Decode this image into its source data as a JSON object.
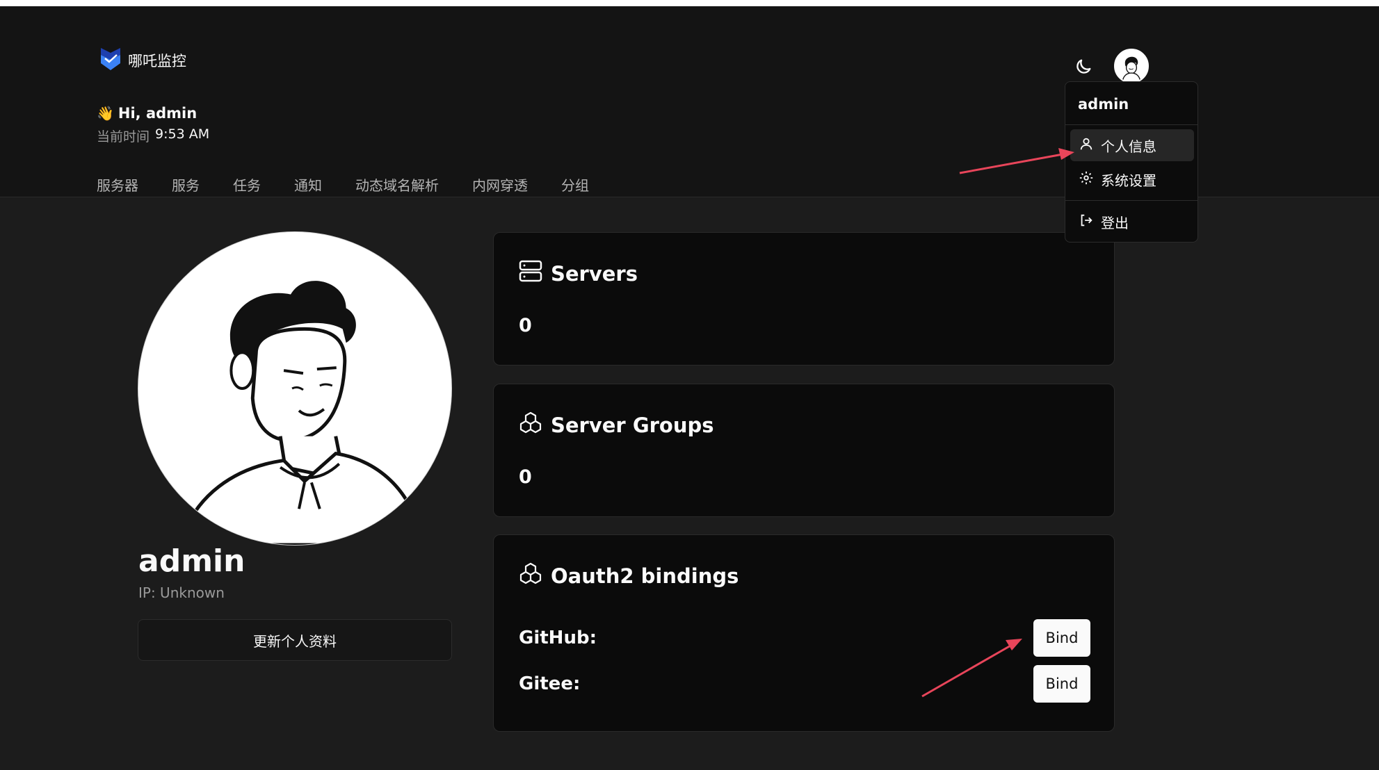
{
  "brand": {
    "name": "哪吒监控",
    "accent": "#2563eb"
  },
  "greeting": {
    "wave": "👋",
    "text": "Hi, admin"
  },
  "time": {
    "label": "当前时间",
    "value": "9:53 AM"
  },
  "nav": [
    "服务器",
    "服务",
    "任务",
    "通知",
    "动态域名解析",
    "内网穿透",
    "分组"
  ],
  "header_icons": {
    "theme": "moon-icon",
    "avatar": "user-avatar"
  },
  "dropdown": {
    "username": "admin",
    "items": [
      {
        "label": "个人信息",
        "icon": "user-icon",
        "active": true
      },
      {
        "label": "系统设置",
        "icon": "gear-icon"
      },
      {
        "label": "登出",
        "icon": "logout-icon"
      }
    ]
  },
  "profile": {
    "name": "admin",
    "ip": "IP: Unknown",
    "update_label": "更新个人资料"
  },
  "cards": {
    "servers": {
      "title": "Servers",
      "value": "0",
      "icon": "server-icon"
    },
    "groups": {
      "title": "Server Groups",
      "value": "0",
      "icon": "boxes-icon"
    },
    "oauth": {
      "title": "Oauth2 bindings",
      "icon": "boxes-icon",
      "providers": [
        {
          "name": "GitHub:",
          "action": "Bind"
        },
        {
          "name": "Gitee:",
          "action": "Bind"
        }
      ]
    }
  },
  "annotation_color": "#e8455a"
}
